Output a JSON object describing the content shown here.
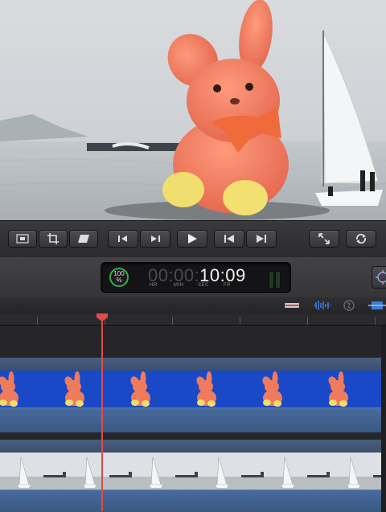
{
  "viewer": {
    "description_shown": "video frame"
  },
  "transport": {
    "buttons": [
      {
        "name": "transform-button",
        "icon": "transform-icon"
      },
      {
        "name": "crop-button",
        "icon": "crop-icon"
      },
      {
        "name": "distort-button",
        "icon": "distort-icon"
      },
      {
        "name": "prev-frame-button",
        "icon": "step-back-icon"
      },
      {
        "name": "next-frame-button",
        "icon": "step-forward-icon"
      },
      {
        "name": "play-button",
        "icon": "play-icon"
      },
      {
        "name": "go-to-start-button",
        "icon": "skip-back-icon"
      },
      {
        "name": "go-to-end-button",
        "icon": "skip-forward-icon"
      },
      {
        "name": "fullscreen-button",
        "icon": "fullscreen-icon"
      },
      {
        "name": "loop-button",
        "icon": "loop-icon"
      }
    ]
  },
  "dashboard": {
    "background_task_percent": "100",
    "percent_sign": "%",
    "timecode_dim": "00:00:",
    "timecode_lit": "10:09",
    "units": [
      "HR",
      "MIN",
      "SEC",
      "FR"
    ]
  },
  "colors": {
    "playhead": "#e24a4a",
    "clip_blue": "#1a49c8",
    "track_header": "#3b4f6d",
    "progress_green": "#2fb04a"
  }
}
